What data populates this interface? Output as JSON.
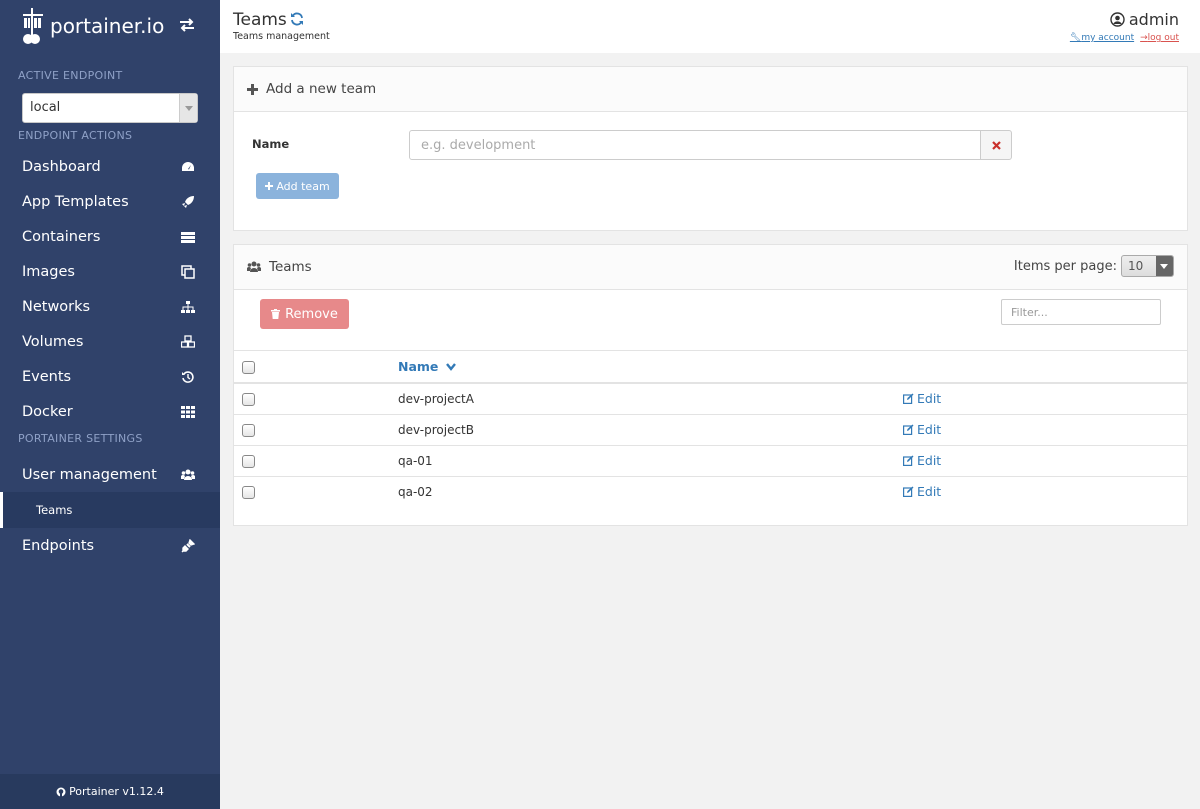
{
  "brand": {
    "name": "portainer.io"
  },
  "sidebar": {
    "active_endpoint_heading": "ACTIVE ENDPOINT",
    "endpoint_value": "local",
    "endpoint_actions_heading": "ENDPOINT ACTIONS",
    "actions": [
      {
        "label": "Dashboard",
        "icon": "tachometer-icon"
      },
      {
        "label": "App Templates",
        "icon": "rocket-icon"
      },
      {
        "label": "Containers",
        "icon": "server-icon"
      },
      {
        "label": "Images",
        "icon": "clone-icon"
      },
      {
        "label": "Networks",
        "icon": "sitemap-icon"
      },
      {
        "label": "Volumes",
        "icon": "cubes-icon"
      },
      {
        "label": "Events",
        "icon": "history-icon"
      },
      {
        "label": "Docker",
        "icon": "th-icon"
      }
    ],
    "settings_heading": "PORTAINER SETTINGS",
    "settings": {
      "user_management": "User management",
      "teams": "Teams",
      "endpoints": "Endpoints"
    },
    "footer": "Portainer v1.12.4"
  },
  "header": {
    "title": "Teams",
    "subtitle": "Teams management",
    "username": "admin",
    "my_account": "my account",
    "log_out": "log out"
  },
  "add_team": {
    "heading": "Add a new team",
    "name_label": "Name",
    "name_placeholder": "e.g. development",
    "button": "Add team"
  },
  "teams_panel": {
    "heading": "Teams",
    "items_per_page_label": "Items per page:",
    "items_per_page": "10",
    "remove_button": "Remove",
    "filter_placeholder": "Filter...",
    "column_name": "Name",
    "edit_label": "Edit",
    "rows": [
      "dev-projectA",
      "dev-projectB",
      "qa-01",
      "qa-02"
    ]
  },
  "colors": {
    "sidebar_bg": "#30426a",
    "link": "#337ab7",
    "danger": "#e7898a",
    "primary_disabled": "#8bb3dc"
  }
}
